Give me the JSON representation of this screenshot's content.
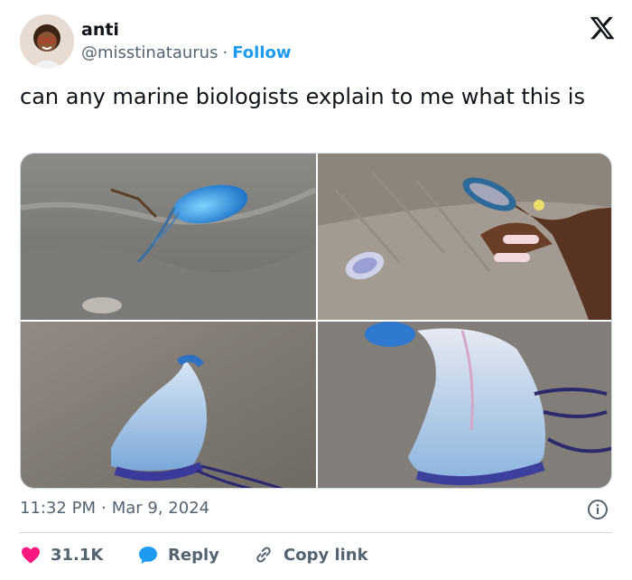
{
  "author": {
    "name": "anti",
    "handle": "@misstinataurus",
    "separator": "·",
    "follow_label": "Follow"
  },
  "tweet": {
    "text": "can any marine biologists explain to me what this is"
  },
  "media": {
    "photos": [
      {
        "subject": "blue man o' war on wet sand"
      },
      {
        "subject": "hand holding blue creature over sand"
      },
      {
        "subject": "translucent float with purple tentacles"
      },
      {
        "subject": "close-up of float with purple tentacles"
      }
    ]
  },
  "meta": {
    "time": "11:32 PM",
    "separator": "·",
    "date": "Mar 9, 2024"
  },
  "actions": {
    "likes": "31.1K",
    "reply_label": "Reply",
    "copy_label": "Copy link"
  },
  "colors": {
    "accent": "#1d9bf0",
    "like": "#f91880",
    "text": "#0f1419",
    "secondary": "#536471"
  }
}
